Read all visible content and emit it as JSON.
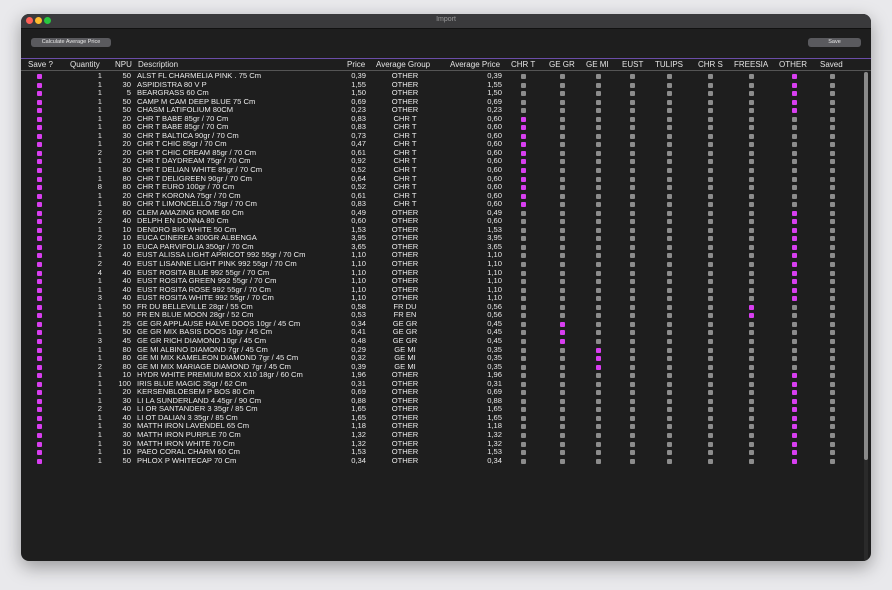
{
  "window": {
    "title": "Import"
  },
  "toolbar": {
    "calc_label": "Calculate Average Price",
    "save_label": "Save"
  },
  "headers": {
    "save": "Save ?",
    "quantity": "Quantity",
    "npu": "NPU",
    "description": "Description",
    "price": "Price",
    "average_group": "Average Group",
    "average_price": "Average Price",
    "chrt": "CHR T",
    "gegr": "GE GR",
    "gemi": "GE MI",
    "eust": "EUST",
    "tulips": "TULIPS",
    "chrs": "CHR S",
    "freesia": "FREESIA",
    "other": "OTHER",
    "saved": "Saved"
  },
  "colors": {
    "accent": "#d83ef0",
    "unchecked": "#8c8c8c",
    "background": "#1e1e1e",
    "divider": "#6b4da8"
  },
  "flag_columns": [
    "chrt",
    "gegr",
    "gemi",
    "eust",
    "tulips",
    "chrs",
    "freesia",
    "other",
    "saved"
  ],
  "rows": [
    {
      "save": true,
      "qty": "1",
      "npu": "50",
      "desc": "ALST FL CHARMELIA PINK . 75 Cm",
      "price": "0,39",
      "group": "OTHER",
      "avg": "0,39",
      "flag": "other"
    },
    {
      "save": true,
      "qty": "1",
      "npu": "30",
      "desc": "ASPIDISTRA 80 V P",
      "price": "1,55",
      "group": "OTHER",
      "avg": "1,55",
      "flag": "other"
    },
    {
      "save": true,
      "qty": "1",
      "npu": "5",
      "desc": "BEARGRASS 60 Cm",
      "price": "1,50",
      "group": "OTHER",
      "avg": "1,50",
      "flag": "other"
    },
    {
      "save": true,
      "qty": "1",
      "npu": "50",
      "desc": "CAMP M CAM DEEP BLUE 75 Cm",
      "price": "0,69",
      "group": "OTHER",
      "avg": "0,69",
      "flag": "other"
    },
    {
      "save": true,
      "qty": "1",
      "npu": "50",
      "desc": "CHASM LATIFOLIUM 80CM",
      "price": "0,23",
      "group": "OTHER",
      "avg": "0,23",
      "flag": "other"
    },
    {
      "save": true,
      "qty": "1",
      "npu": "20",
      "desc": "CHR T BABE 85gr / 70 Cm",
      "price": "0,83",
      "group": "CHR T",
      "avg": "0,60",
      "flag": "chrt"
    },
    {
      "save": true,
      "qty": "1",
      "npu": "80",
      "desc": "CHR T BABE 85gr / 70 Cm",
      "price": "0,83",
      "group": "CHR T",
      "avg": "0,60",
      "flag": "chrt"
    },
    {
      "save": true,
      "qty": "1",
      "npu": "30",
      "desc": "CHR T BALTICA 90gr / 70 Cm",
      "price": "0,73",
      "group": "CHR T",
      "avg": "0,60",
      "flag": "chrt"
    },
    {
      "save": true,
      "qty": "1",
      "npu": "20",
      "desc": "CHR T CHIC 85gr / 70 Cm",
      "price": "0,47",
      "group": "CHR T",
      "avg": "0,60",
      "flag": "chrt"
    },
    {
      "save": true,
      "qty": "2",
      "npu": "20",
      "desc": "CHR T CHIC CREAM 85gr / 70 Cm",
      "price": "0,61",
      "group": "CHR T",
      "avg": "0,60",
      "flag": "chrt"
    },
    {
      "save": true,
      "qty": "1",
      "npu": "20",
      "desc": "CHR T DAYDREAM 75gr / 70 Cm",
      "price": "0,92",
      "group": "CHR T",
      "avg": "0,60",
      "flag": "chrt"
    },
    {
      "save": true,
      "qty": "1",
      "npu": "80",
      "desc": "CHR T DELIAN WHITE 85gr / 70 Cm",
      "price": "0,52",
      "group": "CHR T",
      "avg": "0,60",
      "flag": "chrt"
    },
    {
      "save": true,
      "qty": "1",
      "npu": "80",
      "desc": "CHR T DELIGREEN 90gr / 70 Cm",
      "price": "0,64",
      "group": "CHR T",
      "avg": "0,60",
      "flag": "chrt"
    },
    {
      "save": true,
      "qty": "8",
      "npu": "80",
      "desc": "CHR T EURO 100gr / 70 Cm",
      "price": "0,52",
      "group": "CHR T",
      "avg": "0,60",
      "flag": "chrt"
    },
    {
      "save": true,
      "qty": "1",
      "npu": "20",
      "desc": "CHR T KORONA 75gr / 70 Cm",
      "price": "0,61",
      "group": "CHR T",
      "avg": "0,60",
      "flag": "chrt"
    },
    {
      "save": true,
      "qty": "1",
      "npu": "80",
      "desc": "CHR T LIMONCELLO 75gr / 70 Cm",
      "price": "0,83",
      "group": "CHR T",
      "avg": "0,60",
      "flag": "chrt"
    },
    {
      "save": true,
      "qty": "2",
      "npu": "60",
      "desc": "CLEM AMAZING ROME 60 Cm",
      "price": "0,49",
      "group": "OTHER",
      "avg": "0,49",
      "flag": "other"
    },
    {
      "save": true,
      "qty": "2",
      "npu": "40",
      "desc": "DELPH EN DONNA 80 Cm",
      "price": "0,60",
      "group": "OTHER",
      "avg": "0,60",
      "flag": "other"
    },
    {
      "save": true,
      "qty": "1",
      "npu": "10",
      "desc": "DENDRO BIG WHITE 50 Cm",
      "price": "1,53",
      "group": "OTHER",
      "avg": "1,53",
      "flag": "other"
    },
    {
      "save": true,
      "qty": "2",
      "npu": "10",
      "desc": "EUCA CINEREA 300GR ALBENGA",
      "price": "3,95",
      "group": "OTHER",
      "avg": "3,95",
      "flag": "other"
    },
    {
      "save": true,
      "qty": "2",
      "npu": "10",
      "desc": "EUCA PARVIFOLIA 350gr / 70 Cm",
      "price": "3,65",
      "group": "OTHER",
      "avg": "3,65",
      "flag": "other"
    },
    {
      "save": true,
      "qty": "1",
      "npu": "40",
      "desc": "EUST ALISSA LIGHT APRICOT 992 55gr / 70 Cm",
      "price": "1,10",
      "group": "OTHER",
      "avg": "1,10",
      "flag": "other"
    },
    {
      "save": true,
      "qty": "2",
      "npu": "40",
      "desc": "EUST LISANNE LIGHT PINK 992 55gr / 70 Cm",
      "price": "1,10",
      "group": "OTHER",
      "avg": "1,10",
      "flag": "other"
    },
    {
      "save": true,
      "qty": "4",
      "npu": "40",
      "desc": "EUST ROSITA BLUE 992 55gr / 70 Cm",
      "price": "1,10",
      "group": "OTHER",
      "avg": "1,10",
      "flag": "other"
    },
    {
      "save": true,
      "qty": "1",
      "npu": "40",
      "desc": "EUST ROSITA GREEN 992 55gr / 70 Cm",
      "price": "1,10",
      "group": "OTHER",
      "avg": "1,10",
      "flag": "other"
    },
    {
      "save": true,
      "qty": "1",
      "npu": "40",
      "desc": "EUST ROSITA ROSE 992 55gr / 70 Cm",
      "price": "1,10",
      "group": "OTHER",
      "avg": "1,10",
      "flag": "other"
    },
    {
      "save": true,
      "qty": "3",
      "npu": "40",
      "desc": "EUST ROSITA WHITE 992 55gr / 70 Cm",
      "price": "1,10",
      "group": "OTHER",
      "avg": "1,10",
      "flag": "other"
    },
    {
      "save": true,
      "qty": "1",
      "npu": "50",
      "desc": "FR DU BELLEVILLE 28gr / 55 Cm",
      "price": "0,58",
      "group": "FR DU",
      "avg": "0,56",
      "flag": "freesia"
    },
    {
      "save": true,
      "qty": "1",
      "npu": "50",
      "desc": "FR EN BLUE MOON 28gr / 52 Cm",
      "price": "0,53",
      "group": "FR EN",
      "avg": "0,56",
      "flag": "freesia"
    },
    {
      "save": true,
      "qty": "1",
      "npu": "25",
      "desc": "GE GR APPLAUSE HALVE DOOS 10gr / 45 Cm",
      "price": "0,34",
      "group": "GE GR",
      "avg": "0,45",
      "flag": "gegr"
    },
    {
      "save": true,
      "qty": "1",
      "npu": "50",
      "desc": "GE GR MIX BASIS DOOS 10gr / 45 Cm",
      "price": "0,41",
      "group": "GE GR",
      "avg": "0,45",
      "flag": "gegr"
    },
    {
      "save": true,
      "qty": "3",
      "npu": "45",
      "desc": "GE GR RICH DIAMOND 10gr / 45 Cm",
      "price": "0,48",
      "group": "GE GR",
      "avg": "0,45",
      "flag": "gegr"
    },
    {
      "save": true,
      "qty": "1",
      "npu": "80",
      "desc": "GE MI ALBINO DIAMOND 7gr / 45 Cm",
      "price": "0,29",
      "group": "GE MI",
      "avg": "0,35",
      "flag": "gemi"
    },
    {
      "save": true,
      "qty": "1",
      "npu": "80",
      "desc": "GE MI MIX KAMELEON DIAMOND 7gr / 45 Cm",
      "price": "0,32",
      "group": "GE MI",
      "avg": "0,35",
      "flag": "gemi"
    },
    {
      "save": true,
      "qty": "2",
      "npu": "80",
      "desc": "GE MI MIX MARIAGE DIAMOND 7gr / 45 Cm",
      "price": "0,39",
      "group": "GE MI",
      "avg": "0,35",
      "flag": "gemi"
    },
    {
      "save": true,
      "qty": "1",
      "npu": "10",
      "desc": "HYDR WHITE PREMIUM BOX X10 18gr / 60 Cm",
      "price": "1,96",
      "group": "OTHER",
      "avg": "1,96",
      "flag": "other"
    },
    {
      "save": true,
      "qty": "1",
      "npu": "100",
      "desc": "IRIS BLUE MAGIC 35gr / 62 Cm",
      "price": "0,31",
      "group": "OTHER",
      "avg": "0,31",
      "flag": "other"
    },
    {
      "save": true,
      "qty": "1",
      "npu": "20",
      "desc": "KERSENBLOESEM P BOS 80 Cm",
      "price": "0,69",
      "group": "OTHER",
      "avg": "0,69",
      "flag": "other"
    },
    {
      "save": true,
      "qty": "1",
      "npu": "30",
      "desc": "LI LA SUNDERLAND 4 45gr / 90 Cm",
      "price": "0,88",
      "group": "OTHER",
      "avg": "0,88",
      "flag": "other"
    },
    {
      "save": true,
      "qty": "2",
      "npu": "40",
      "desc": "LI OR SANTANDER 3 35gr / 85 Cm",
      "price": "1,65",
      "group": "OTHER",
      "avg": "1,65",
      "flag": "other"
    },
    {
      "save": true,
      "qty": "1",
      "npu": "40",
      "desc": "LI OT DALIAN 3 35gr / 85 Cm",
      "price": "1,65",
      "group": "OTHER",
      "avg": "1,65",
      "flag": "other"
    },
    {
      "save": true,
      "qty": "1",
      "npu": "30",
      "desc": "MATTH IRON LAVENDEL 65 Cm",
      "price": "1,18",
      "group": "OTHER",
      "avg": "1,18",
      "flag": "other"
    },
    {
      "save": true,
      "qty": "1",
      "npu": "30",
      "desc": "MATTH IRON PURPLE 70 Cm",
      "price": "1,32",
      "group": "OTHER",
      "avg": "1,32",
      "flag": "other"
    },
    {
      "save": true,
      "qty": "1",
      "npu": "30",
      "desc": "MATTH IRON WHITE 70 Cm",
      "price": "1,32",
      "group": "OTHER",
      "avg": "1,32",
      "flag": "other"
    },
    {
      "save": true,
      "qty": "1",
      "npu": "10",
      "desc": "PAEO CORAL CHARM 60 Cm",
      "price": "1,53",
      "group": "OTHER",
      "avg": "1,53",
      "flag": "other"
    },
    {
      "save": true,
      "qty": "1",
      "npu": "50",
      "desc": "PHLOX P WHITECAP 70 Cm",
      "price": "0,34",
      "group": "OTHER",
      "avg": "0,34",
      "flag": "other"
    }
  ]
}
